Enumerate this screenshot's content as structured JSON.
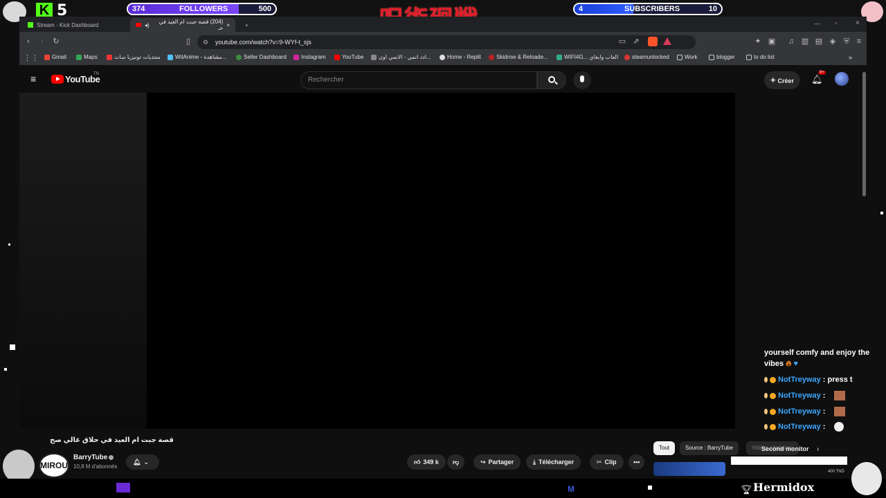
{
  "overlay": {
    "kick_count": "5",
    "followers_current": "374",
    "followers_label": "FOLLOWERS",
    "followers_goal": "500",
    "followers_fraction": 0.75,
    "subscribers_current": "4",
    "subscribers_label": "SUBSCRIBERS",
    "subscribers_goal": "10",
    "subscribers_fraction": 0.4,
    "title_art": "呪術廻戦",
    "streamer_badge": "MIROU",
    "watermark": "Hermidox"
  },
  "browser": {
    "tabs": [
      {
        "label": "Stream - Kick Dashboard"
      },
      {
        "label": "(204) قصة جبت ام العيد في حـ"
      }
    ],
    "new_tab": "+",
    "url": "youtube.com/watch?v=9-WYf-t_sjs",
    "bookmarks": [
      "Gmail",
      "Maps",
      "منتديات تونيزيا سات",
      "WitAnime - مشاهدة...",
      "Seller Dashboard",
      "Instagram",
      "YouTube",
      "ادد انمي - الانمي اون...",
      "Home - Replit",
      "Skidrow & Reloade...",
      "WIFI4G... العاب وابغاي",
      "steamunlocked",
      "Work",
      "blogger",
      "to do list"
    ]
  },
  "youtube": {
    "logo": "YouTube",
    "logo_suffix": "TN",
    "search_placeholder": "Rechercher",
    "create_label": "Créer",
    "notif_badge": "9+",
    "video_title": "قصة جبت ام العيد في حلاق غالي صح",
    "channel_name": "BarryTube",
    "channel_subs": "10,8 M d'abonnés",
    "likes": "349 k",
    "share": "Partager",
    "download": "Télécharger",
    "clip": "Clip",
    "chips": [
      "Tout",
      "Source : BarryTube",
      "Vidéos similaires"
    ],
    "rec_price": "400 TND"
  },
  "chat": {
    "intro_line1": "yourself comfy and enjoy the",
    "intro_line2": "vibes",
    "messages": [
      {
        "user": "NotTreyway",
        "text": ": press t"
      },
      {
        "user": "NotTreyway",
        "text": ":"
      },
      {
        "user": "NotTreyway",
        "text": ":"
      },
      {
        "user": "NotTreyway",
        "text": ":"
      }
    ],
    "second_monitor": "Second monitor"
  },
  "colors": {
    "kick_green": "#53fc18",
    "followers_purple": "#6a35ee",
    "subs_blue": "#2048e8",
    "title_red": "#e01e2a",
    "chat_user": "#3ea6ff",
    "yt_red": "#ff0000"
  }
}
